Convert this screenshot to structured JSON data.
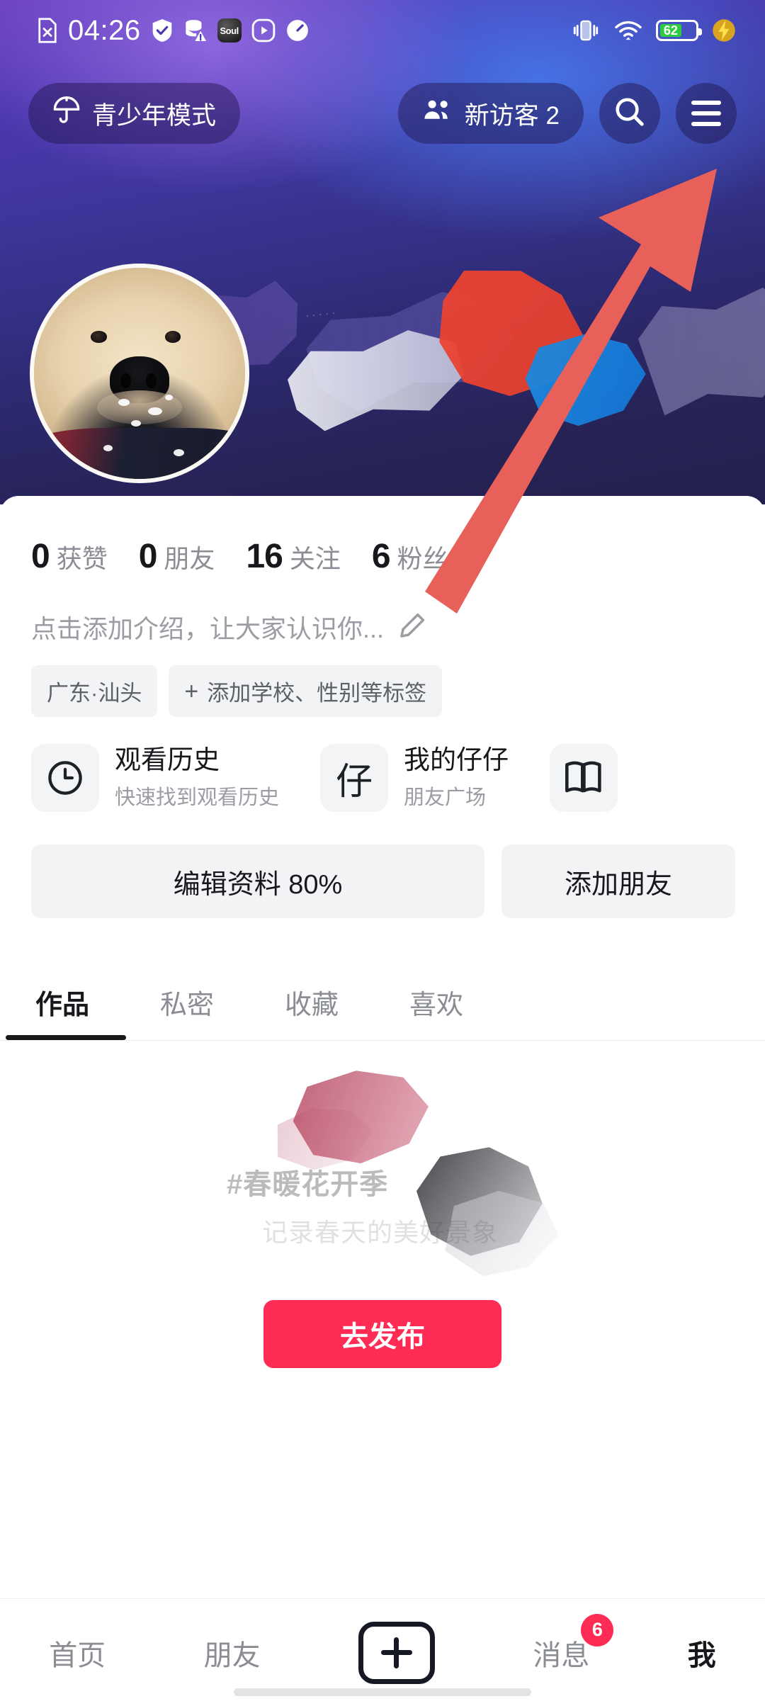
{
  "status_bar": {
    "time": "04:26",
    "left_icons": [
      "file-x-icon",
      "shield-check-icon",
      "database-warning-icon",
      "soul-app-icon",
      "play-circle-icon",
      "speedometer-icon"
    ],
    "soul_label": "Soul",
    "right_icons": [
      "vibrate-icon",
      "wifi-icon",
      "battery-icon",
      "charge-bolt-icon"
    ],
    "battery_level": "62"
  },
  "topbar": {
    "teen_mode_label": "青少年模式",
    "visitors_label": "新访客 2",
    "search_icon": "search-icon",
    "menu_icon": "hamburger-menu-icon"
  },
  "profile": {
    "avatar_alt": "golden-retriever-puppy-avatar",
    "stats": [
      {
        "num": "0",
        "label": "获赞"
      },
      {
        "num": "0",
        "label": "朋友"
      },
      {
        "num": "16",
        "label": "关注"
      },
      {
        "num": "6",
        "label": "粉丝"
      }
    ],
    "bio_placeholder": "点击添加介绍，让大家认识你...",
    "bio_edit_icon": "pencil-icon",
    "tags": [
      {
        "text": "广东·汕头",
        "add": false
      },
      {
        "text": "添加学校、性别等标签",
        "add": true
      }
    ]
  },
  "shortcuts": [
    {
      "icon": "clock-icon",
      "title": "观看历史",
      "subtitle": "快速找到观看历史"
    },
    {
      "icon": "zai-character-icon",
      "icon_text": "仔",
      "title": "我的仔仔",
      "subtitle": "朋友广场"
    },
    {
      "icon": "book-icon",
      "title": "",
      "subtitle": ""
    }
  ],
  "actions": [
    {
      "label": "编辑资料 80%"
    },
    {
      "label": "添加朋友"
    }
  ],
  "tabs": [
    {
      "label": "作品",
      "active": true
    },
    {
      "label": "私密",
      "active": false
    },
    {
      "label": "收藏",
      "active": false
    },
    {
      "label": "喜欢",
      "active": false
    }
  ],
  "content": {
    "promo_line1": "#春暖花开季",
    "promo_line2": "记录春天的美好景象",
    "publish_label": "去发布"
  },
  "bottom_nav": [
    {
      "label": "首页",
      "active": false,
      "badge": ""
    },
    {
      "label": "朋友",
      "active": false,
      "badge": ""
    },
    {
      "label": "",
      "active": false,
      "badge": "",
      "icon": "plus-create-icon"
    },
    {
      "label": "消息",
      "active": false,
      "badge": "6"
    },
    {
      "label": "我",
      "active": true,
      "badge": ""
    }
  ],
  "annotation": {
    "arrow_color": "#e8605a",
    "arrow_target": "hamburger-menu-icon"
  },
  "colors": {
    "accent_red": "#fe2c55",
    "banner_purple": "#4b37ae",
    "text_primary": "#16181c",
    "text_secondary": "#8a8d93",
    "chip_bg": "#f2f3f5"
  }
}
